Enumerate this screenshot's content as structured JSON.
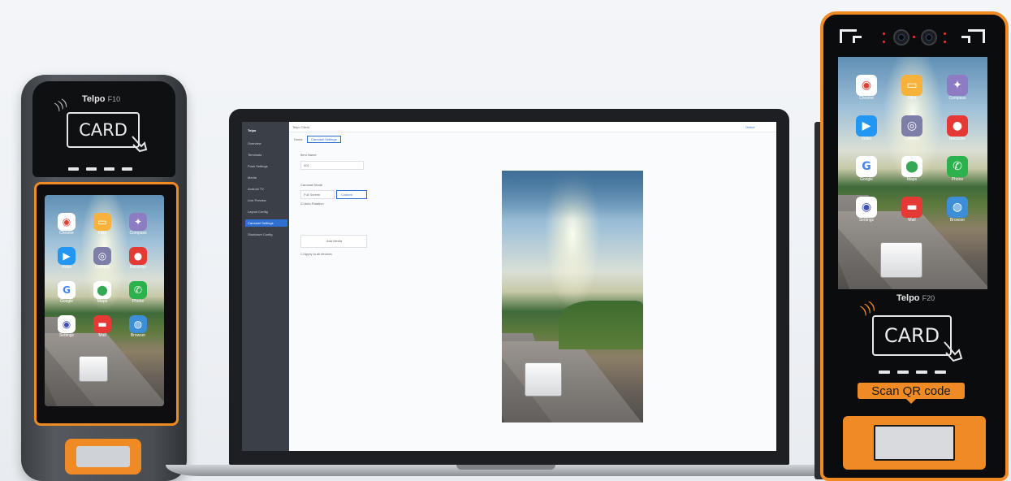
{
  "left_terminal": {
    "brand": "Telpo",
    "model": "F10",
    "card_label": "CARD",
    "apps": [
      {
        "icon": "chrome-icon",
        "label": "Chrome",
        "bg": "#ffffff",
        "glyph": "◉",
        "color": "#db4437"
      },
      {
        "icon": "files-icon",
        "label": "Files",
        "bg": "#f6b23a",
        "glyph": "▭",
        "color": "#ffffff"
      },
      {
        "icon": "compass-icon",
        "label": "Compass",
        "bg": "#8e7cc3",
        "glyph": "✦",
        "color": "#ffffff"
      },
      {
        "icon": "video-icon",
        "label": "Video",
        "bg": "#2196f3",
        "glyph": "▶",
        "color": "#ffffff"
      },
      {
        "icon": "camera-icon",
        "label": "Camera",
        "bg": "#7e7fa8",
        "glyph": "◎",
        "color": "#ffffff"
      },
      {
        "icon": "recorder-icon",
        "label": "Recorder",
        "bg": "#e53935",
        "glyph": "●",
        "color": "#ffffff"
      },
      {
        "icon": "google-icon",
        "label": "Google",
        "bg": "#ffffff",
        "glyph": "G",
        "color": "#4285f4"
      },
      {
        "icon": "maps-icon",
        "label": "Maps",
        "bg": "#ffffff",
        "glyph": "⬤",
        "color": "#34a853"
      },
      {
        "icon": "phone-icon",
        "label": "Phone",
        "bg": "#2bb24c",
        "glyph": "✆",
        "color": "#ffffff"
      },
      {
        "icon": "settings-icon",
        "label": "Settings",
        "bg": "#ffffff",
        "glyph": "◉",
        "color": "#3f51b5"
      },
      {
        "icon": "mail-icon",
        "label": "Mail",
        "bg": "#e53935",
        "glyph": "▬",
        "color": "#ffffff"
      },
      {
        "icon": "globe-icon",
        "label": "Browser",
        "bg": "#3c8ed8",
        "glyph": "◍",
        "color": "#ffffff"
      }
    ]
  },
  "laptop": {
    "window_title": "Telpo Client",
    "tabs": [
      "Home",
      "Carousel Settings"
    ],
    "sidebar_title": "Telpo",
    "sidebar_items": [
      "Overview",
      "Terminals",
      "Push Settings",
      "Media",
      "Android TV",
      "Live Preview",
      "Layout Config",
      "Carousel Settings",
      "Shutdown Config"
    ],
    "active_sidebar_index": 7,
    "form": {
      "field1_label": "Item Name",
      "field1_value": "001",
      "section_label": "Carousel Mode",
      "option_a": "Full Screen",
      "option_b": "Custom",
      "checkbox1": "Auto Rotation",
      "button_label": "Add Media",
      "checkbox2": "Apply to all devices"
    },
    "status_right": "Online"
  },
  "right_kiosk": {
    "brand": "Telpo",
    "model": "F20",
    "card_label": "CARD",
    "scan_label": "Scan QR code",
    "apps": [
      {
        "icon": "chrome-icon",
        "label": "Chrome",
        "bg": "#ffffff",
        "glyph": "◉",
        "color": "#db4437"
      },
      {
        "icon": "files-icon",
        "label": "Files",
        "bg": "#f6b23a",
        "glyph": "▭",
        "color": "#ffffff"
      },
      {
        "icon": "compass-icon",
        "label": "Compass",
        "bg": "#8e7cc3",
        "glyph": "✦",
        "color": "#ffffff"
      },
      {
        "icon": "video-icon",
        "label": "Video",
        "bg": "#2196f3",
        "glyph": "▶",
        "color": "#ffffff"
      },
      {
        "icon": "camera-icon",
        "label": "Camera",
        "bg": "#7e7fa8",
        "glyph": "◎",
        "color": "#ffffff"
      },
      {
        "icon": "recorder-icon",
        "label": "Recorder",
        "bg": "#e53935",
        "glyph": "●",
        "color": "#ffffff"
      },
      {
        "icon": "google-icon",
        "label": "Google",
        "bg": "#ffffff",
        "glyph": "G",
        "color": "#4285f4"
      },
      {
        "icon": "maps-icon",
        "label": "Maps",
        "bg": "#ffffff",
        "glyph": "⬤",
        "color": "#34a853"
      },
      {
        "icon": "phone-icon",
        "label": "Phone",
        "bg": "#2bb24c",
        "glyph": "✆",
        "color": "#ffffff"
      },
      {
        "icon": "settings-icon",
        "label": "Settings",
        "bg": "#ffffff",
        "glyph": "◉",
        "color": "#3f51b5"
      },
      {
        "icon": "mail-icon",
        "label": "Mail",
        "bg": "#e53935",
        "glyph": "▬",
        "color": "#ffffff"
      },
      {
        "icon": "globe-icon",
        "label": "Browser",
        "bg": "#3c8ed8",
        "glyph": "◍",
        "color": "#ffffff"
      }
    ]
  },
  "colors": {
    "accent": "#f08a24",
    "device_dark": "#0f1012",
    "sidebar": "#3b4048",
    "active_item": "#2e6fd1"
  }
}
